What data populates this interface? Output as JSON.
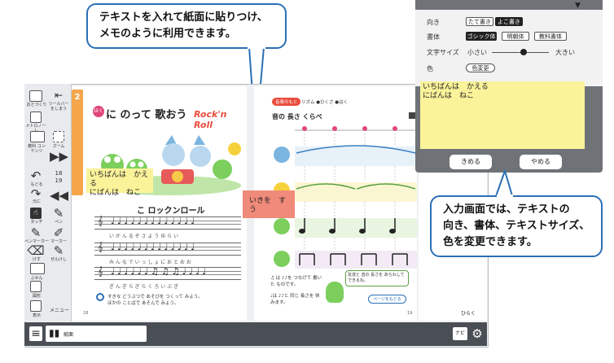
{
  "callout_top": {
    "line1": "テキストを入れて紙面に貼りつけ、",
    "line2": "メモのように利用できます。"
  },
  "callout_right": {
    "line1": "入力画面では、テキストの",
    "line2": "向き、書体、テキストサイズ、",
    "line3": "色を変更できます。"
  },
  "toolbar": {
    "top_label": "ツールバー\nをしまう",
    "items": [
      "おとづくり",
      "メトロノーム",
      "教科\nコンテンツ",
      "ズーム",
      "もどる",
      "元に",
      "タッチ",
      "ペン",
      "ペンマーカー",
      "マーカー",
      "けす",
      "ぜんけし",
      "ふせん",
      "図形",
      "表示",
      "メニュー"
    ],
    "page_top": "18",
    "page_bottom": "19"
  },
  "left_page": {
    "page_number": "2",
    "title": "に のって 歌おう",
    "title_prefix": "ほく",
    "logo": "Rock'n Roll",
    "song_title": "こ ロックンロール",
    "lyrics": [
      "い か ん る ぞ さ よ う ゆ ら い",
      "み ん な で い っ し ょ に お と お お",
      "ぎ ん ぎ ら ぎ ら く ろ い ぶ ぎ"
    ],
    "bullet1": "すきな どうぶつで あそびを つくって みよう。",
    "bullet2": "ほかの ことばで あそんで みよう。",
    "page_num_bottom": "18"
  },
  "right_page": {
    "header_tag": "音楽のもと",
    "header_items": "リズム ●ひくさ ●はく",
    "title": "音の 長さ くらべ",
    "note_text": "♫ は ♪♪を つなげて 書いた ものです。",
    "note_text2": "♩は ♪♪と 同じ 長さを 休みます。",
    "frog_text": "友達と 音の 長さを あらわして できるね。",
    "next": "ページをもどる",
    "page_num_bottom": "19"
  },
  "sticky_notes": [
    {
      "text": "いちばんは　かえる\nにばんは　ねこ"
    },
    {
      "text": "いきを　すう"
    }
  ],
  "panel": {
    "orientation_label": "向き",
    "orientation_options": [
      "たて書き",
      "よこ書き"
    ],
    "orientation_selected": "よこ書き",
    "font_label": "書体",
    "font_options": [
      "ゴシック体",
      "明朝体",
      "教科書体"
    ],
    "font_selected": "ゴシック体",
    "size_label": "文字サイズ",
    "size_small": "小さい",
    "size_large": "大きい",
    "size_value": 0.55,
    "color_label": "色",
    "color_button": "色変更",
    "text_value": "いちばんは　かえる\nにばんは　ねこ",
    "confirm_button": "きめる",
    "cancel_button": "やめる"
  },
  "bottom": {
    "book_label": "紙面",
    "navi": "ナビ",
    "right_tab": "ひらく"
  },
  "colors": {
    "accent_blue": "#2b6fb5",
    "sticky_yellow": "#fbf39a",
    "sticky_red": "#f08a7a",
    "panel_gray": "#6f7378"
  }
}
